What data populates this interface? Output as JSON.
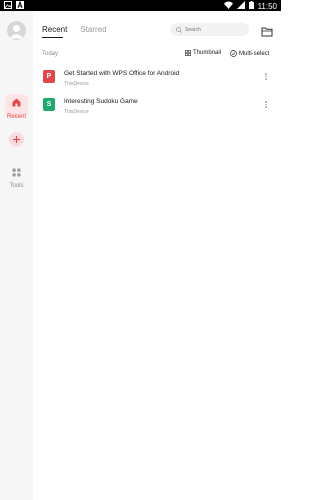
{
  "status_bar": {
    "time": "11:50",
    "left_icons": [
      "gallery-icon",
      "notification-a-icon"
    ],
    "right_icons": [
      "wifi-icon",
      "signal-icon",
      "battery-icon"
    ]
  },
  "rail": {
    "recent_label": "Recent",
    "tools_label": "Tools"
  },
  "header": {
    "tabs": [
      {
        "label": "Recent",
        "active": true
      },
      {
        "label": "Starred",
        "active": false
      }
    ],
    "search_placeholder": "Search"
  },
  "section": {
    "title": "Today",
    "thumbnail_label": "Thumbnail",
    "multiselect_label": "Multi-select"
  },
  "files": [
    {
      "name": "Get Started with WPS Office for Android",
      "location": "ThisDevice",
      "icon": "pdf-icon",
      "icon_letter": "P",
      "color": "#e2474b"
    },
    {
      "name": "Interesting Sudoku Game",
      "location": "ThisDevice",
      "icon": "spreadsheet-icon",
      "icon_letter": "S",
      "color": "#1fab6e"
    }
  ],
  "colors": {
    "accent": "#e2474b",
    "rail_bg": "#f6f6f6"
  }
}
